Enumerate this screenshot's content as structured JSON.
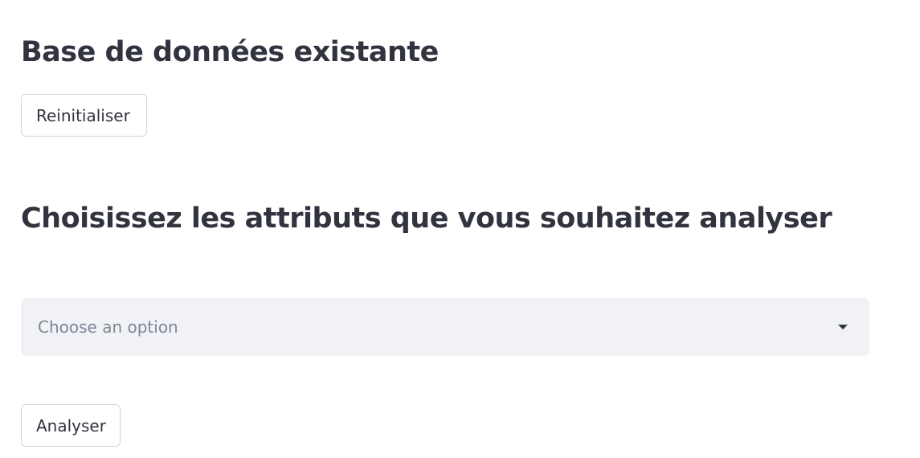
{
  "sections": {
    "database": {
      "title": "Base de données existante",
      "reset_label": "Reinitialiser"
    },
    "attributes": {
      "title": "Choisissez les attributs que vous souhaitez analyser",
      "select_placeholder": "Choose an option",
      "select_icon": "caret-down-icon",
      "analyse_label": "Analyser"
    }
  },
  "colors": {
    "text": "#31333f",
    "select_bg": "#f0f2f6",
    "placeholder": "#808495",
    "button_border": "#d6d6d9"
  }
}
